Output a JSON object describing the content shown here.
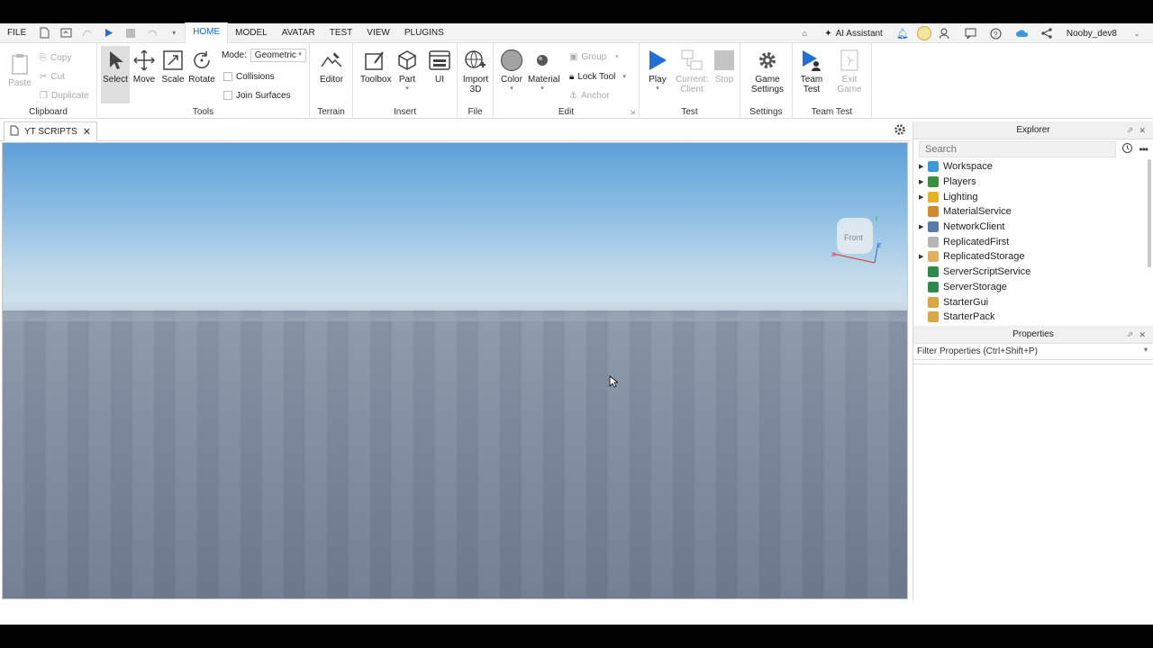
{
  "menubar": {
    "file": "FILE",
    "tabs": [
      "HOME",
      "MODEL",
      "AVATAR",
      "TEST",
      "VIEW",
      "PLUGINS"
    ],
    "ai_assistant": "AI Assistant",
    "user": "Nooby_dev8"
  },
  "ribbon": {
    "clipboard": {
      "paste": "Paste",
      "copy": "Copy",
      "cut": "Cut",
      "duplicate": "Duplicate",
      "label": "Clipboard"
    },
    "tools": {
      "select": "Select",
      "move": "Move",
      "scale": "Scale",
      "rotate": "Rotate",
      "mode_label": "Mode:",
      "mode_value": "Geometric",
      "collisions": "Collisions",
      "join_surfaces": "Join Surfaces",
      "label": "Tools"
    },
    "terrain": {
      "editor": "Editor",
      "label": "Terrain"
    },
    "insert": {
      "toolbox": "Toolbox",
      "part": "Part",
      "ui": "UI",
      "label": "Insert"
    },
    "file": {
      "import_line1": "Import",
      "import_line2": "3D",
      "label": "File"
    },
    "edit": {
      "color": "Color",
      "material": "Material",
      "group": "Group",
      "lock_tool": "Lock Tool",
      "anchor": "Anchor",
      "label": "Edit"
    },
    "test": {
      "play": "Play",
      "current_line1": "Current:",
      "current_line2": "Client",
      "stop": "Stop",
      "label": "Test"
    },
    "settings": {
      "game_line1": "Game",
      "game_line2": "Settings",
      "label": "Settings"
    },
    "team_test": {
      "team_line1": "Team",
      "team_line2": "Test",
      "exit_line1": "Exit",
      "exit_line2": "Game",
      "label": "Team Test"
    }
  },
  "document_tab": {
    "label": "YT SCRIPTS"
  },
  "viewport": {
    "view_cube_face": "Front",
    "axis_x": "X",
    "axis_z": "Z"
  },
  "explorer": {
    "title": "Explorer",
    "search_placeholder": "Search",
    "items": [
      {
        "label": "Workspace",
        "expandable": true,
        "color": "#3a9ad9"
      },
      {
        "label": "Players",
        "expandable": true,
        "color": "#3a8f3a"
      },
      {
        "label": "Lighting",
        "expandable": true,
        "color": "#e6b422"
      },
      {
        "label": "MaterialService",
        "expandable": false,
        "color": "#d08a2a"
      },
      {
        "label": "NetworkClient",
        "expandable": true,
        "color": "#5a7aa8"
      },
      {
        "label": "ReplicatedFirst",
        "expandable": false,
        "color": "#b5b5b5"
      },
      {
        "label": "ReplicatedStorage",
        "expandable": true,
        "color": "#e0b060"
      },
      {
        "label": "ServerScriptService",
        "expandable": false,
        "color": "#2d8a4a"
      },
      {
        "label": "ServerStorage",
        "expandable": false,
        "color": "#2d8a4a"
      },
      {
        "label": "StarterGui",
        "expandable": false,
        "color": "#d9a640"
      },
      {
        "label": "StarterPack",
        "expandable": false,
        "color": "#d9a640"
      }
    ]
  },
  "properties": {
    "title": "Properties",
    "filter": "Filter Properties (Ctrl+Shift+P)"
  }
}
